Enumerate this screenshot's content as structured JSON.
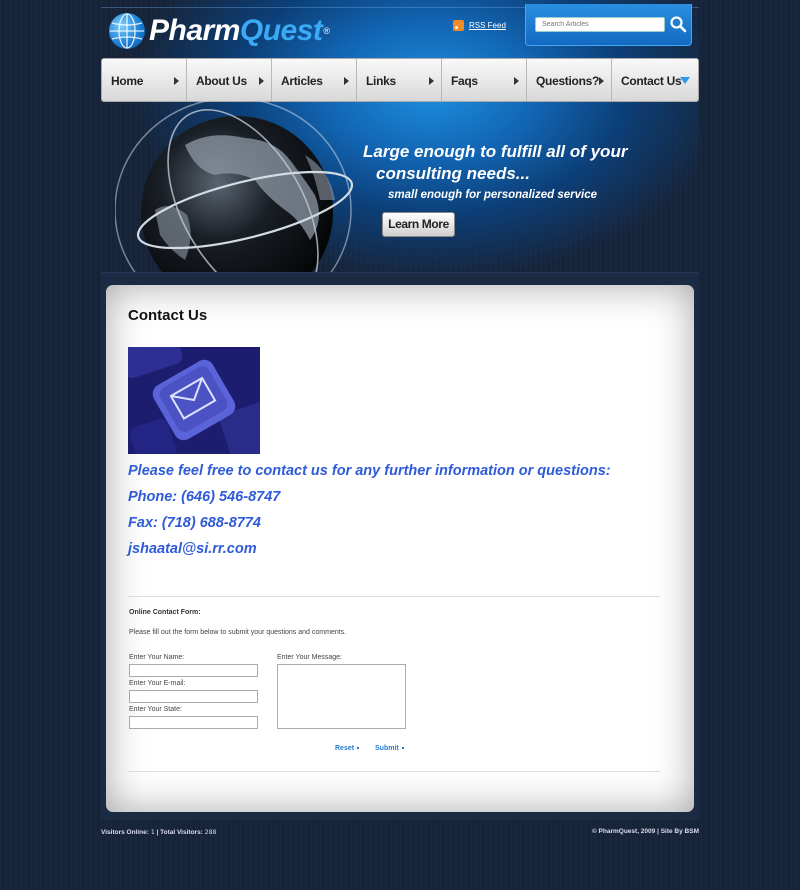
{
  "header": {
    "logo_text_main": "Pharm",
    "logo_text_accent": "Quest",
    "logo_reg": "®",
    "rss_label": "RSS Feed",
    "search_placeholder": "Search Articles"
  },
  "nav": {
    "items": [
      {
        "label": "Home"
      },
      {
        "label": "About Us"
      },
      {
        "label": "Articles"
      },
      {
        "label": "Links"
      },
      {
        "label": "Faqs"
      },
      {
        "label": "Questions?"
      },
      {
        "label": "Contact Us"
      }
    ]
  },
  "banner": {
    "line1": "Large enough to fulfill all of your",
    "line2": "consulting needs...",
    "line3": "small enough for personalized service",
    "button_label": "Learn More"
  },
  "main": {
    "title": "Contact Us",
    "intro": "Please feel free to contact us for any further information or questions:",
    "phone": "Phone: (646) 546-8747",
    "fax": "Fax: (718) 688-8774",
    "email": "jshaatal@si.rr.com"
  },
  "form": {
    "heading": "Online Contact Form:",
    "intro": "Please fill out the form below to submit your questions and comments.",
    "name_label": "Enter Your Name:",
    "email_label": "Enter Your E-mail:",
    "state_label": "Enter Your State:",
    "message_label": "Enter Your Message:",
    "reset_label": "Reset",
    "submit_label": "Submit"
  },
  "footer": {
    "visitors_online_label": "Visitors Online:",
    "visitors_online": "1",
    "separator": "|",
    "total_label": "Total Visitors:",
    "total_visitors": "288",
    "right_text": "© PharmQuest, 2009 | Site By BSM"
  },
  "colors": {
    "background": "#16243a",
    "accent_blue": "#1c8fe0",
    "link_blue": "#2f5bd8",
    "nav_arrow_active": "#2a9ae8"
  },
  "icons": [
    "globe-logo-icon",
    "rss-icon",
    "search-icon",
    "envelope-key-icon"
  ]
}
